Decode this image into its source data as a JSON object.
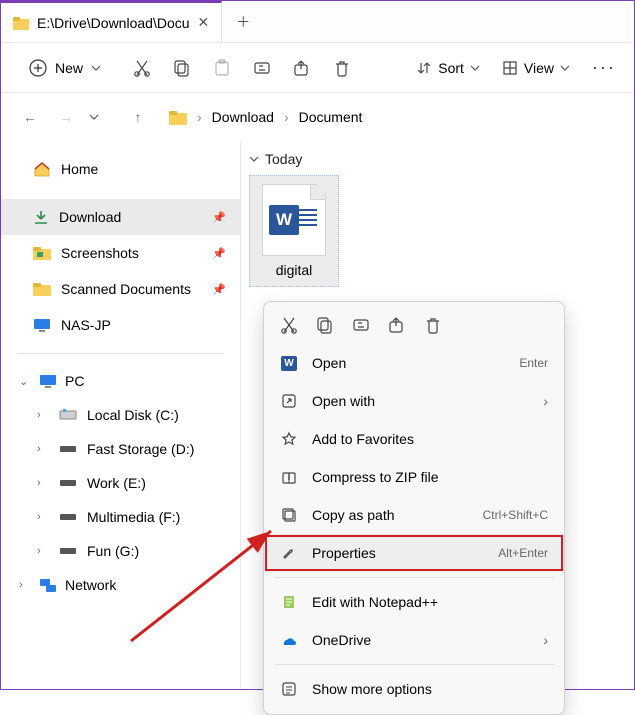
{
  "titlebar": {
    "tab_title": "E:\\Drive\\Download\\Docu"
  },
  "toolbar": {
    "new_label": "New",
    "sort_label": "Sort",
    "view_label": "View"
  },
  "breadcrumb": [
    "Download",
    "Document"
  ],
  "sidebar": {
    "home": "Home",
    "pinned": [
      {
        "label": "Download"
      },
      {
        "label": "Screenshots"
      },
      {
        "label": "Scanned Documents"
      },
      {
        "label": "NAS-JP"
      }
    ],
    "pc": "PC",
    "drives": [
      "Local Disk (C:)",
      "Fast Storage (D:)",
      "Work (E:)",
      "Multimedia (F:)",
      "Fun (G:)"
    ],
    "network": "Network"
  },
  "content": {
    "group": "Today",
    "file_name": "digital"
  },
  "context_menu": {
    "open": "Open",
    "open_shortcut": "Enter",
    "open_with": "Open with",
    "add_fav": "Add to Favorites",
    "compress": "Compress to ZIP file",
    "copy_path": "Copy as path",
    "copy_path_shortcut": "Ctrl+Shift+C",
    "properties": "Properties",
    "properties_shortcut": "Alt+Enter",
    "edit_npp": "Edit with Notepad++",
    "onedrive": "OneDrive",
    "show_more": "Show more options"
  }
}
